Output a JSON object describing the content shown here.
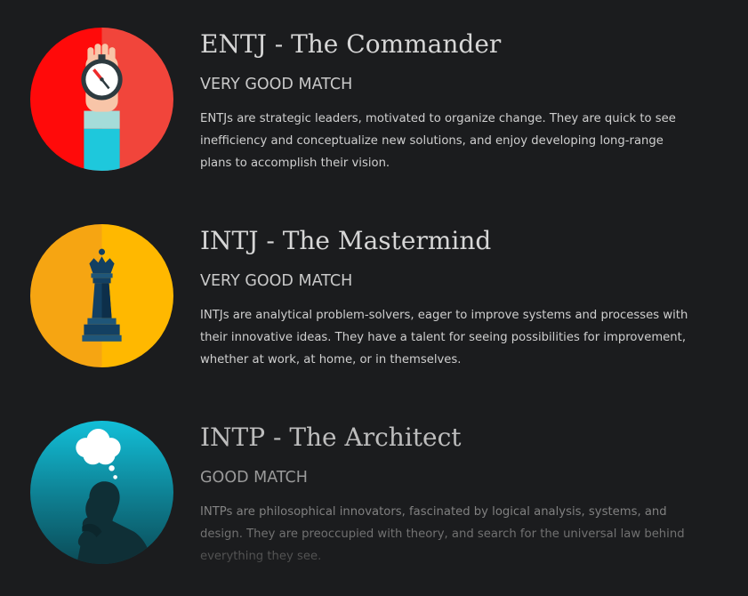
{
  "personalities": [
    {
      "title": "ENTJ - The Commander",
      "match": "VERY GOOD MATCH",
      "description": "ENTJs are strategic leaders, motivated to organize change. They are quick to see inefficiency and conceptualize new solutions, and enjoy developing long-range plans to accomplish their vision.",
      "icon": "hand-with-stopwatch-icon",
      "color": "#e8231e"
    },
    {
      "title": "INTJ - The Mastermind",
      "match": "VERY GOOD MATCH",
      "description": "INTJs are analytical problem-solvers, eager to improve systems and processes with their innovative ideas. They have a talent for seeing possibilities for improvement, whether at work, at home, or in themselves.",
      "icon": "chess-queen-icon",
      "color": "#f6ab0e"
    },
    {
      "title": "INTP - The Architect",
      "match": "GOOD MATCH",
      "description": "INTPs are philosophical innovators, fascinated by logical analysis, systems, and design. They are preoccupied with theory, and search for the universal law behind everything they see.",
      "icon": "thinker-with-thought-bubble-icon",
      "color": "#14b6cc"
    }
  ]
}
